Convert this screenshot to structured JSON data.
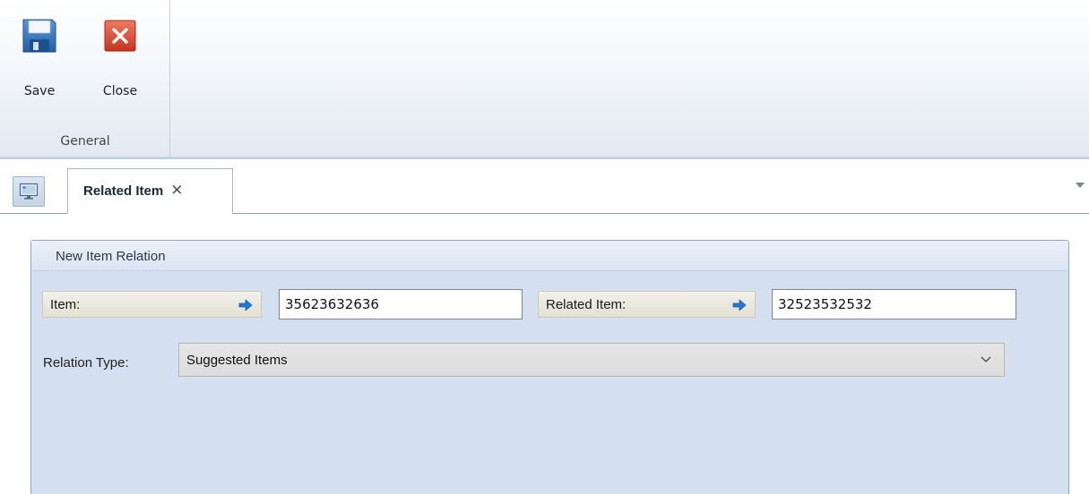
{
  "ribbon": {
    "save_label": "Save",
    "close_label": "Close",
    "group_label": "General"
  },
  "tabs": {
    "active_title": "Related Item",
    "close_glyph": "✕"
  },
  "panel": {
    "title": "New Item Relation",
    "item_label": "Item:",
    "item_value": "35623632636",
    "related_label": "Related Item:",
    "related_value": "32523532532",
    "relation_type_label": "Relation Type:",
    "relation_type_value": "Suggested Items"
  },
  "icons": {
    "save": "floppy-disk-icon",
    "close": "close-x-icon",
    "tab_monitor": "monitor-icon",
    "arrow": "arrow-right-icon",
    "chevron": "chevron-down-icon"
  },
  "colors": {
    "panel_bg": "#d4dff0",
    "close_red": "#d9452b",
    "save_blue": "#2f6fb7",
    "arrow_blue": "#1f7ad6"
  }
}
